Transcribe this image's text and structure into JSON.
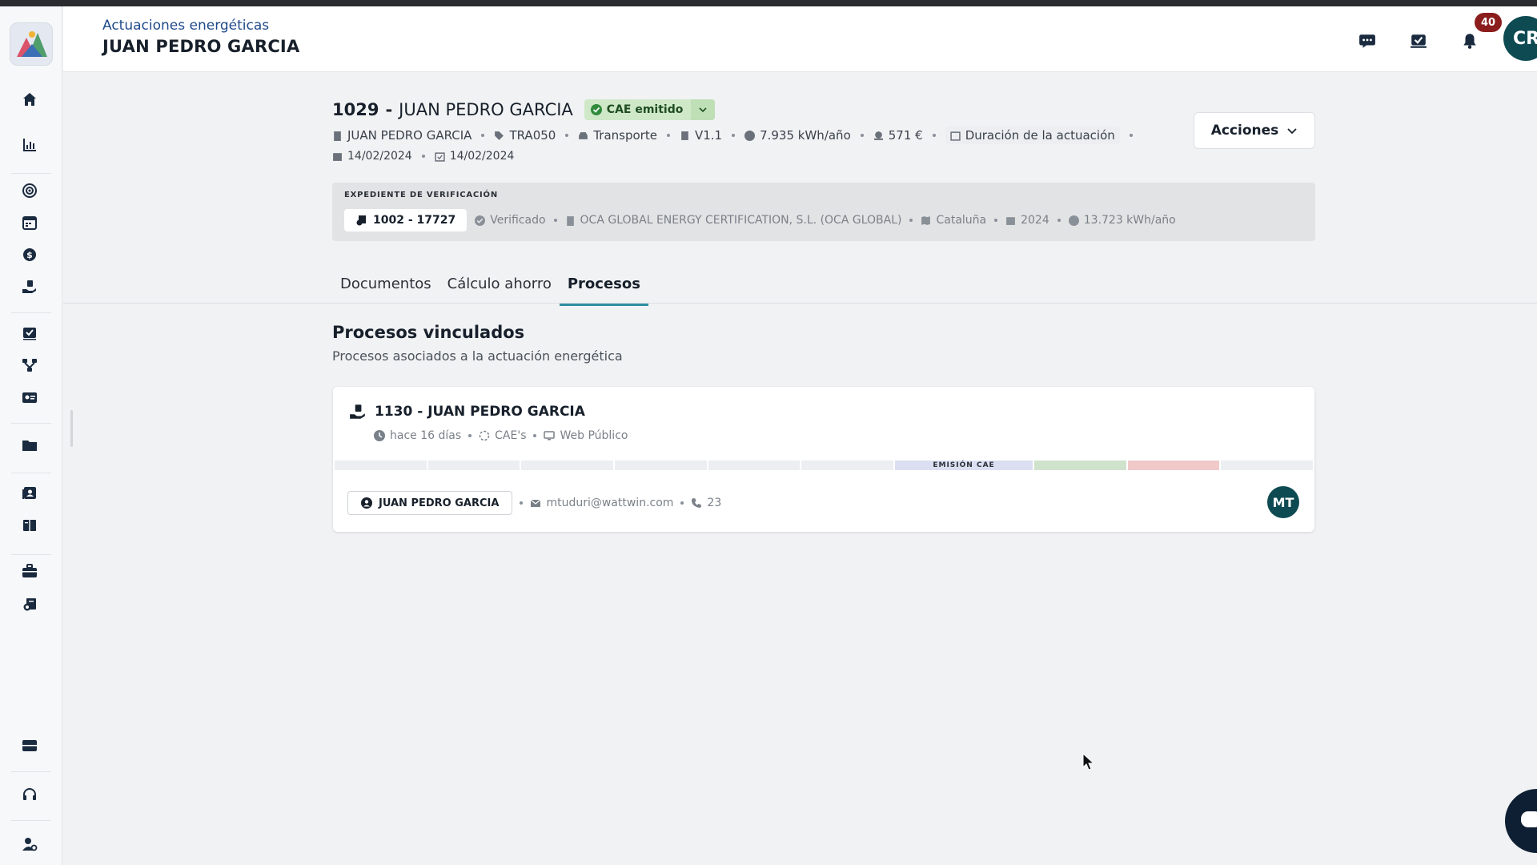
{
  "header": {
    "breadcrumb": "Actuaciones energéticas",
    "title": "JUAN PEDRO GARCIA",
    "notifications_count": "40",
    "user_initials": "CR"
  },
  "sidebar": {
    "items": [
      "home",
      "charts",
      "target",
      "calendar",
      "money",
      "hand-holding",
      "checklist",
      "workflow",
      "id-card",
      "folder",
      "contacts",
      "book",
      "briefcase",
      "certificate",
      "inbox",
      "headset",
      "user-settings"
    ]
  },
  "summary": {
    "id": "1029",
    "dash": "-",
    "name": "JUAN PEDRO GARCIA",
    "status": "CAE emitido",
    "status_color": "#cfe8c8",
    "owner": "JUAN PEDRO GARCIA",
    "code": "TRA050",
    "sector": "Transporte",
    "version": "V1.1",
    "energy": "7.935 kWh/año",
    "amount": "571 €",
    "duration": "Duración de la actuación",
    "date_start": "14/02/2024",
    "date_end": "14/02/2024"
  },
  "actions": {
    "label": "Acciones"
  },
  "verification": {
    "label": "EXPEDIENTE DE VERIFICACIÓN",
    "code": "1002 - 17727",
    "state": "Verificado",
    "company": "OCA GLOBAL ENERGY CERTIFICATION, S.L. (OCA GLOBAL)",
    "region": "Cataluña",
    "year": "2024",
    "energy": "13.723 kWh/año"
  },
  "tabs": [
    {
      "label": "Documentos",
      "active": false
    },
    {
      "label": "Cálculo ahorro",
      "active": false
    },
    {
      "label": "Procesos",
      "active": true
    }
  ],
  "section": {
    "title": "Procesos vinculados",
    "subtitle": "Procesos asociados a la actuación energética"
  },
  "process_card": {
    "title": "1130 - JUAN PEDRO GARCIA",
    "time": "hace 16 días",
    "type": "CAE's",
    "channel": "Web Público",
    "stage_label": "EMISIÓN CAE",
    "stage_colors": {
      "current": "#dcdff1",
      "green": "#cfe3cc",
      "red": "#f0c9c9"
    },
    "contact": "JUAN PEDRO GARCIA",
    "email": "mtuduri@wattwin.com",
    "phone": "23",
    "assignee_initials": "MT"
  },
  "colors": {
    "accent": "#2f8ea0",
    "brand_dark": "#0e4a52",
    "badge": "#8b1d1d"
  }
}
